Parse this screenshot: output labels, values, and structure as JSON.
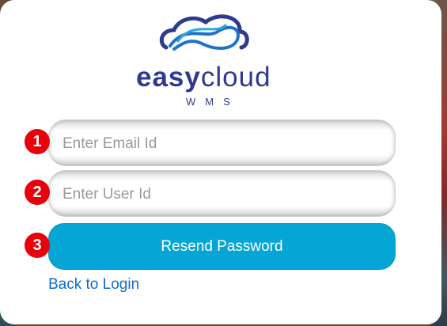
{
  "brand": {
    "word_bold": "easy",
    "word_light": "cloud",
    "product": "WMS",
    "logo_icon": "cloud-logo-icon"
  },
  "form": {
    "email_placeholder": "Enter Email Id",
    "email_value": "",
    "user_placeholder": "Enter User Id",
    "user_value": "",
    "submit_label": "Resend Password",
    "back_link_label": "Back to Login"
  },
  "markers": [
    "1",
    "2",
    "3"
  ],
  "colors": {
    "brand_navy": "#2f3a8f",
    "logo_blue": "#1e73c8",
    "button_blue": "#05a6d6",
    "link_blue": "#0f6ec6",
    "marker_red": "#e8000b"
  }
}
